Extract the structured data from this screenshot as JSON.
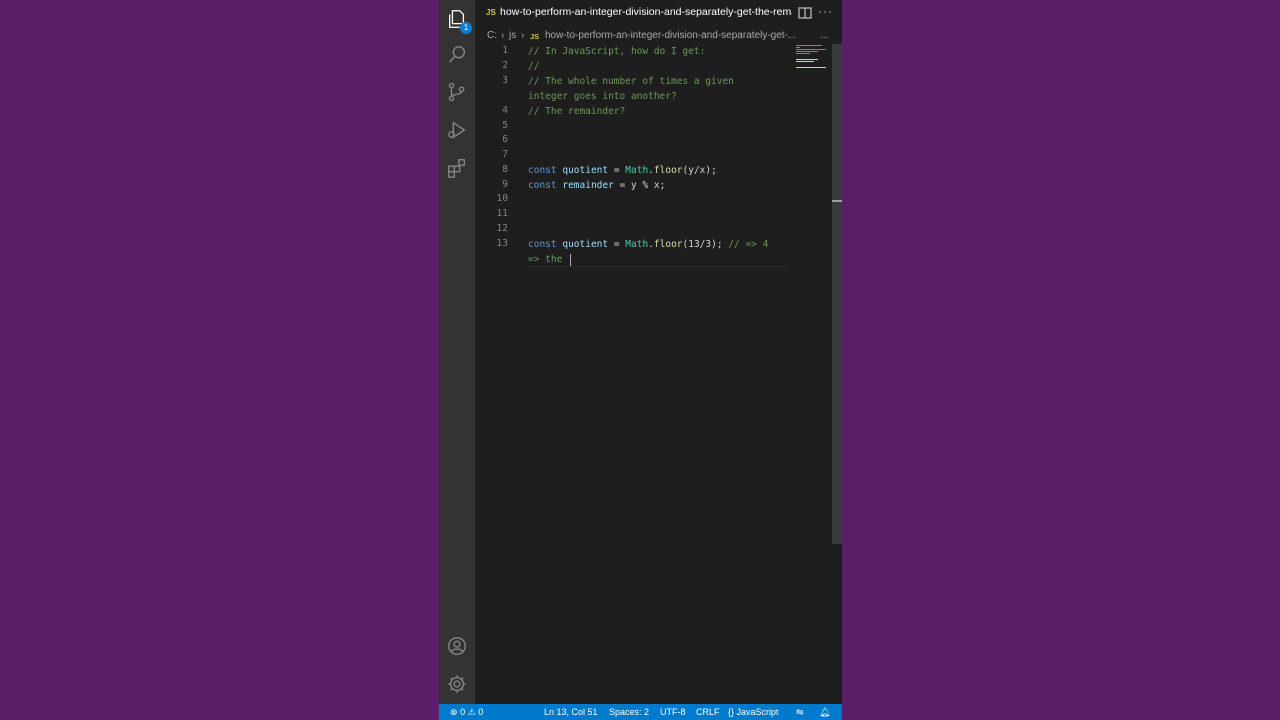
{
  "tab": {
    "lang_badge": "JS",
    "filename": "how-to-perform-an-integer-division-and-separately-get-the-remainder-in-javascript.js",
    "more": "···"
  },
  "breadcrumb": {
    "drive": "C:",
    "sep1": "›",
    "folder": "js",
    "sep2": "›",
    "lang_badge": "JS",
    "file": "how-to-perform-an-integer-division-and-separately-get-...",
    "more": "..."
  },
  "activity": {
    "explorer_badge": "1"
  },
  "editor": {
    "line_numbers": [
      "1",
      "2",
      "3",
      "4",
      "5",
      "6",
      "7",
      "8",
      "9",
      "10",
      "11",
      "12",
      "13"
    ],
    "lines": {
      "l1": "// In JavaScript, how do I get:",
      "l2": "//",
      "l3a": "// The whole number of times a given",
      "l3b": "integer goes into another?",
      "l4": "// The remainder?",
      "l8": {
        "kw": "const",
        "name": "quotient",
        "eq": " = ",
        "obj": "Math",
        "dot": ".",
        "fn": "floor",
        "args": "(y/x);"
      },
      "l9": {
        "kw": "const",
        "name": "remainder",
        "rest": " = y % x;"
      },
      "l13": {
        "kw": "const",
        "name": "quotient",
        "eq": " = ",
        "obj": "Math",
        "dot": ".",
        "fn": "floor",
        "args": "(13/3); ",
        "comment": "// => 4",
        "comment_wrap": "=> the "
      }
    }
  },
  "status": {
    "errors": "0",
    "warnings": "0",
    "position": "Ln 13, Col 51",
    "spaces": "Spaces: 2",
    "encoding": "UTF-8",
    "eol": "CRLF",
    "language": "JavaScript"
  },
  "colors": {
    "background": "#5b1f6a",
    "editor": "#1e1e1e",
    "activity_bar": "#333333",
    "status_bar": "#007acc",
    "comment": "#6a9955",
    "keyword": "#569cd6",
    "variable": "#9cdcfe",
    "type": "#4ec9b0",
    "function": "#dcdcaa"
  }
}
